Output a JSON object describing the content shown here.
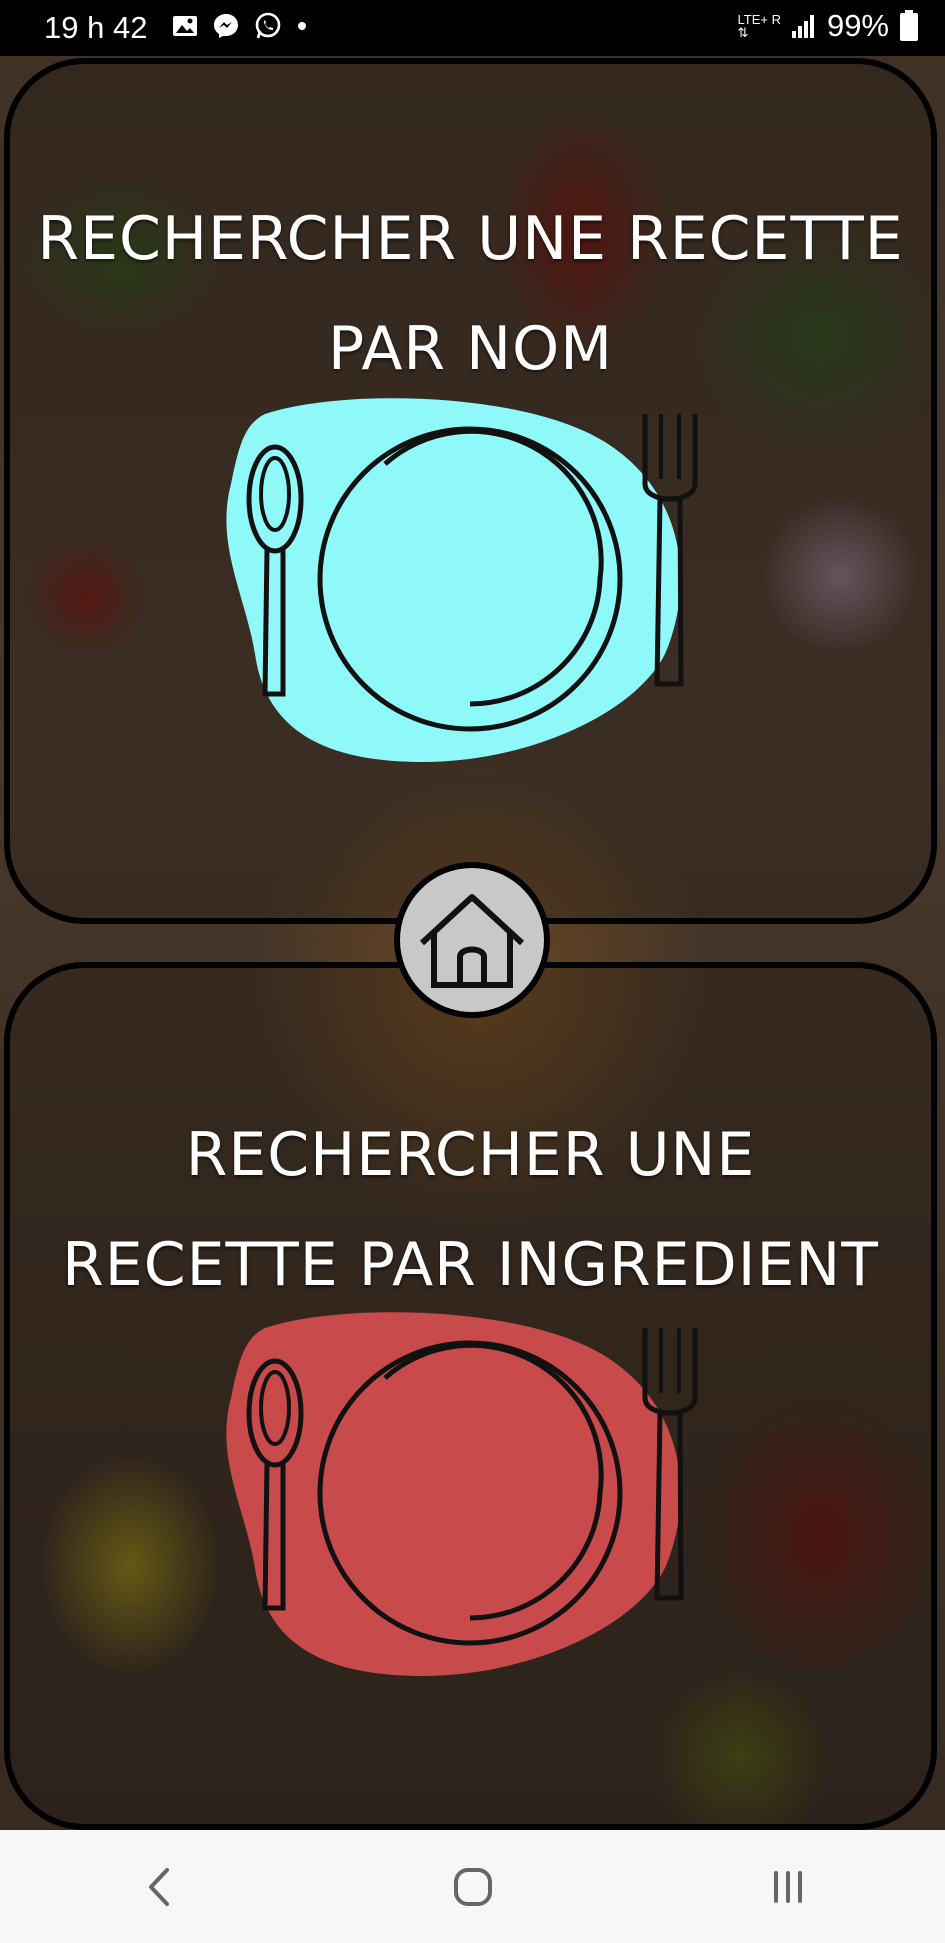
{
  "status_bar": {
    "time": "19 h 42",
    "network": "LTE+ R",
    "battery": "99%",
    "icons": [
      "image-icon",
      "messenger-icon",
      "whatsapp-icon",
      "dot-icon",
      "signal-icon",
      "battery-icon"
    ]
  },
  "search_by_name": {
    "title_line1": "RECHERCHER UNE RECETTE",
    "title_line2": "PAR NOM",
    "plate_color": "#8ff8f9"
  },
  "search_by_ingredient": {
    "title_line1": "RECHERCHER UNE",
    "title_line2": "RECETTE PAR INGREDIENT",
    "plate_color": "#c84a4a"
  },
  "home_button": {
    "icon": "home-icon",
    "color": "#c8c8c8"
  },
  "nav_bar": {
    "icons": [
      "back-icon",
      "home-circle-icon",
      "recents-icon"
    ]
  }
}
